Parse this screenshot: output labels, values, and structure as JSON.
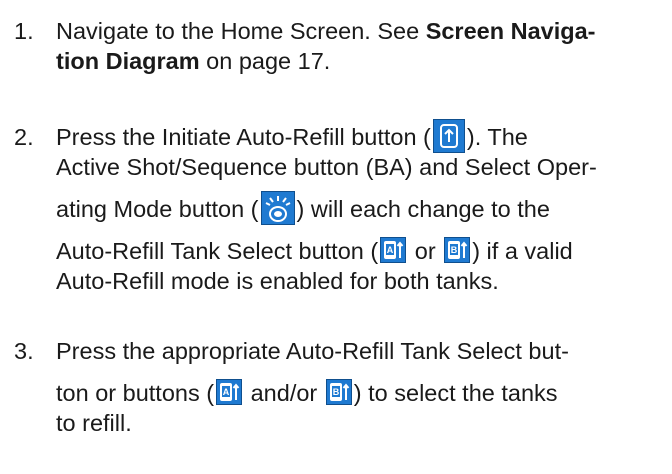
{
  "steps": [
    {
      "number": "1.",
      "line1_a": "Navigate to the Home Screen. See ",
      "line1_bold": "Screen Naviga-",
      "line2_bold": "tion Diagram",
      "line2_b": " on page 17."
    },
    {
      "number": "2.",
      "line1_a": "Press the Initiate Auto-Refill button (",
      "line1_b": "). The",
      "line2": "Active Shot/Sequence button (BA) and Select Oper-",
      "line3_a": "ating Mode button (",
      "line3_b": ") will each change to the",
      "line4_a": "Auto-Refill Tank Select button (",
      "line4_or": " or ",
      "line4_b": ") if a valid",
      "line5": "Auto-Refill mode is enabled for both tanks."
    },
    {
      "number": "3.",
      "line1": "Press the appropriate Auto-Refill Tank Select but-",
      "line2_a": "ton or buttons (",
      "line2_andor": " and/or ",
      "line2_b": ") to select the tanks",
      "line3": "to refill."
    }
  ],
  "icons": {
    "tank_a_letter": "A",
    "tank_b_letter": "B",
    "icon_color": "#1f7ad1"
  }
}
